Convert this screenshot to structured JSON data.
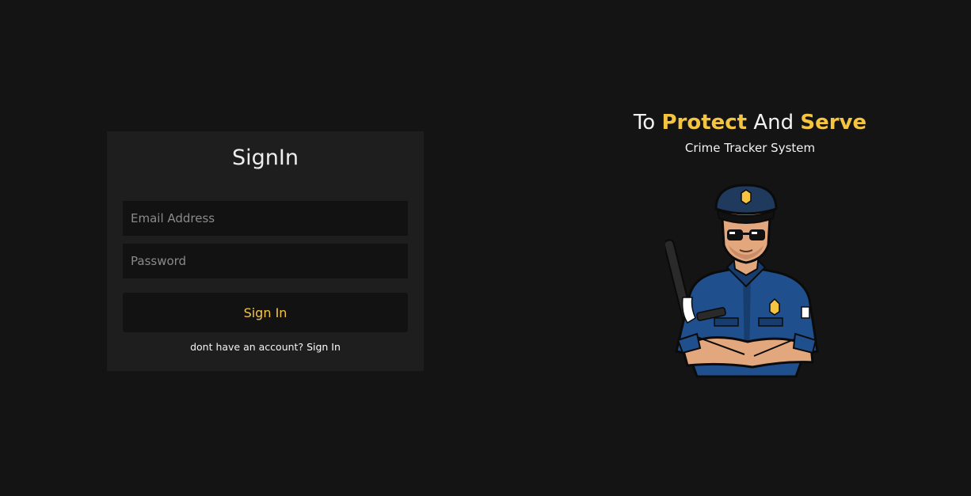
{
  "signin": {
    "title": "SignIn",
    "email_placeholder": "Email Address",
    "password_placeholder": "Password",
    "submit_label": "Sign In",
    "alt_prompt": "dont have an account? ",
    "alt_link": "Sign In"
  },
  "hero": {
    "heading_word1": "To ",
    "heading_word2": "Protect",
    "heading_word3": " And ",
    "heading_word4": "Serve",
    "subtitle": "Crime Tracker System",
    "mascot_icon": "police-officer-icon"
  },
  "colors": {
    "background": "#141414",
    "card": "#1e1e1e",
    "input": "#121212",
    "accent": "#f5c542",
    "text": "#f2f2f2"
  }
}
